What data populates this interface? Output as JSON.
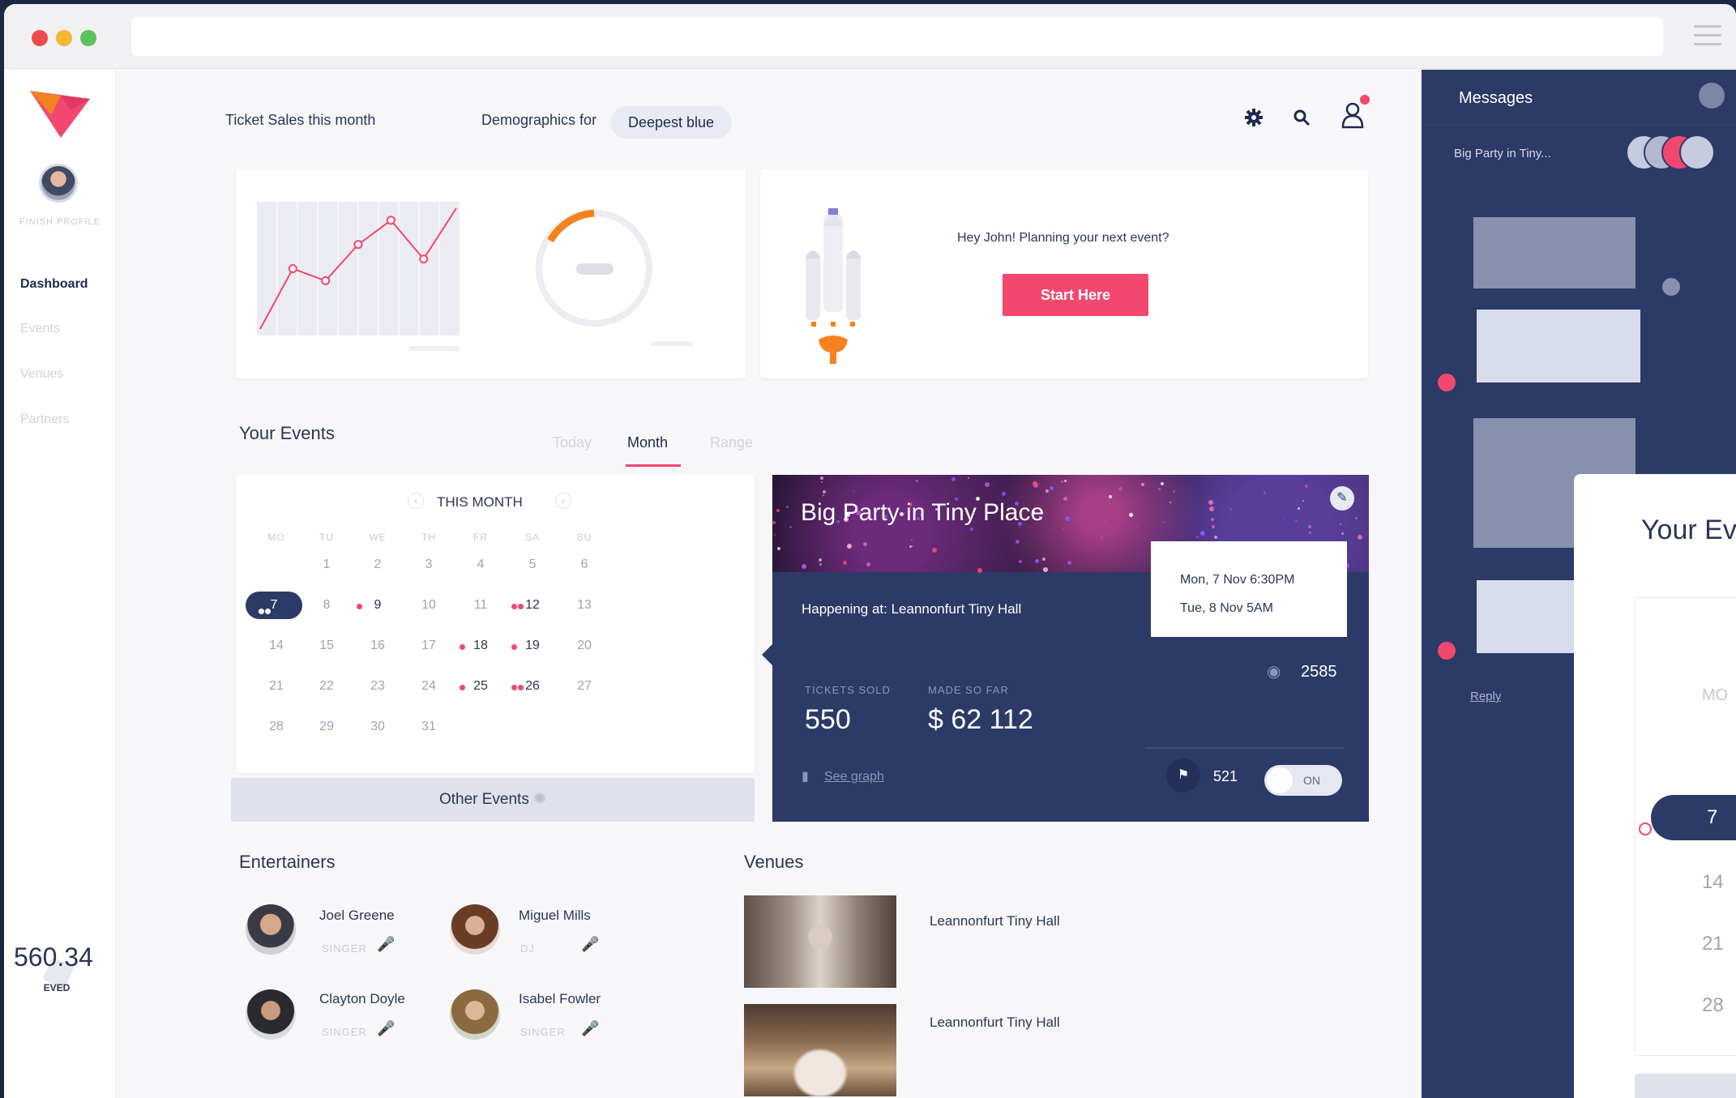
{
  "header": {
    "ticket_sales": "Ticket Sales this month",
    "demographics_label": "Demographics for",
    "demographics_value": "Deepest blue"
  },
  "sidebar": {
    "profile_caption": "FINISH PROFILE",
    "nav": [
      "Dashboard",
      "Events",
      "Venues",
      "Partners"
    ],
    "balance": "560.34",
    "balance_unit": "EVED"
  },
  "promo": {
    "text": "Hey John! Planning your next event?",
    "button": "Start Here"
  },
  "events": {
    "title": "Your Events",
    "tabs": [
      "Today",
      "Month",
      "Range"
    ],
    "calendar": {
      "title": "THIS MONTH",
      "day_names": [
        "MO",
        "TU",
        "WE",
        "TH",
        "FR",
        "SA",
        "SU"
      ],
      "weeks": [
        [
          "",
          "1",
          "2",
          "3",
          "4",
          "5",
          "6"
        ],
        [
          "7",
          "8",
          "9",
          "10",
          "11",
          "12",
          "13"
        ],
        [
          "14",
          "15",
          "16",
          "17",
          "18",
          "19",
          "20"
        ],
        [
          "21",
          "22",
          "23",
          "24",
          "25",
          "26",
          "27"
        ],
        [
          "28",
          "29",
          "30",
          "31",
          "",
          "",
          ""
        ]
      ],
      "selected_day": "7"
    },
    "other_events": "Other Events"
  },
  "event_card": {
    "title": "Big Party in Tiny Place",
    "location": "Happening at: Leannonfurt Tiny Hall",
    "start": "Mon, 7 Nov 6:30PM",
    "end": "Tue, 8 Nov 5AM",
    "views": "2585",
    "tickets_label": "TICKETS SOLD",
    "tickets": "550",
    "made_label": "MADE SO FAR",
    "made": "$ 62 112",
    "see_graph": "See graph",
    "comments": "521",
    "toggle": "ON"
  },
  "entertainers": {
    "title": "Entertainers",
    "items": [
      {
        "name": "Joel Greene",
        "role": "SINGER"
      },
      {
        "name": "Miguel Mills",
        "role": "DJ"
      },
      {
        "name": "Clayton Doyle",
        "role": "SINGER"
      },
      {
        "name": "Isabel Fowler",
        "role": "SINGER"
      }
    ]
  },
  "venues": {
    "title": "Venues",
    "items": [
      "Leannonfurt Tiny Hall",
      "Leannonfurt Tiny Hall"
    ]
  },
  "messages": {
    "title": "Messages",
    "thread": "Big Party in Tiny...",
    "reply": "Reply"
  },
  "overlay": {
    "title": "Your Ev",
    "day_name": "MO",
    "days": [
      "7",
      "14",
      "21",
      "28"
    ]
  },
  "chart_data": {
    "type": "line",
    "x": [
      1,
      2,
      3,
      4,
      5,
      6,
      7
    ],
    "y": [
      0,
      50,
      40,
      70,
      90,
      58,
      100
    ],
    "title": "",
    "xlabel": "",
    "ylabel": ""
  },
  "colors": {
    "accent": "#f2476f",
    "navy": "#2c3a67",
    "orange": "#f5821f"
  }
}
